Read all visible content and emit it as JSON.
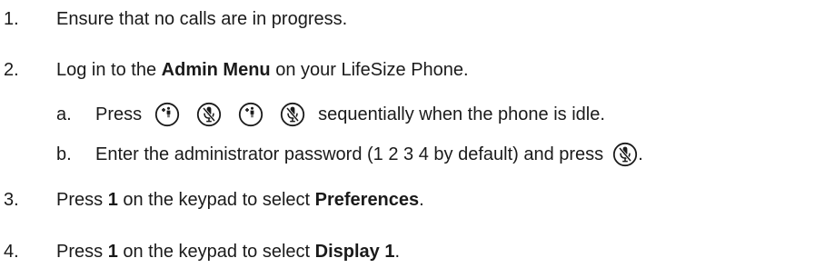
{
  "steps": [
    {
      "num": "1.",
      "text": "Ensure that no calls are in progress."
    },
    {
      "num": "2.",
      "pre": "Log in to the ",
      "bold": "Admin Menu",
      "post": " on your LifeSize Phone.",
      "substeps": [
        {
          "letter": "a.",
          "pre": "Press",
          "icons": [
            "add-call-icon",
            "mute-microphone-icon",
            "add-call-icon",
            "mute-microphone-icon"
          ],
          "post": "sequentially when the phone is idle."
        },
        {
          "letter": "b.",
          "pre": "Enter the administrator password (1 2 3 4 by default) and press",
          "icons": [
            "mute-microphone-icon"
          ],
          "post": "."
        }
      ]
    },
    {
      "num": "3.",
      "pre": "Press ",
      "bold1": "1",
      "mid": " on the keypad to select ",
      "bold2": "Preferences",
      "post": "."
    },
    {
      "num": "4.",
      "pre": "Press ",
      "bold1": "1",
      "mid": " on the keypad to select ",
      "bold2": "Display 1",
      "post": "."
    }
  ],
  "icon_add_label": "add",
  "colors": {
    "text": "#1a1a1a",
    "icon_stroke": "#1a1a1a"
  }
}
